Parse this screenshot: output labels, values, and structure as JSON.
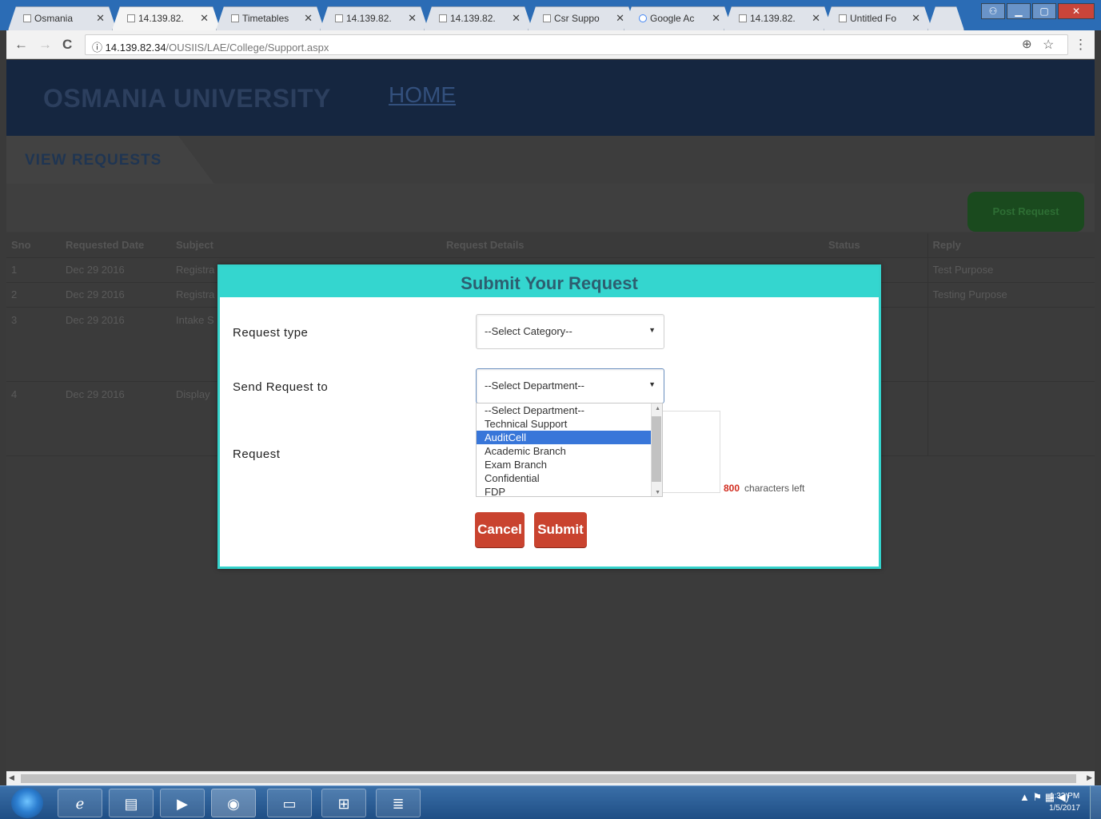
{
  "browser": {
    "tabs": [
      {
        "label": "Osmania",
        "active": false
      },
      {
        "label": "14.139.82.",
        "active": true
      },
      {
        "label": "Timetables",
        "active": false
      },
      {
        "label": "14.139.82.",
        "active": false
      },
      {
        "label": "14.139.82.",
        "active": false
      },
      {
        "label": "Csr Suppo",
        "active": false
      },
      {
        "label": "Google Ac",
        "active": false
      },
      {
        "label": "14.139.82.",
        "active": false
      },
      {
        "label": "Untitled Fo",
        "active": false
      }
    ],
    "url_host": "14.139.82.34",
    "url_path": "/OUSIIS/LAE/College/Support.aspx",
    "back_icon": "←",
    "forward_icon": "→",
    "reload_icon": "C",
    "zoom_icon": "⊕",
    "star_icon": "☆",
    "menu_icon": "⋮"
  },
  "site": {
    "title": "OSMANIA UNIVERSITY",
    "home_link": "HOME",
    "section_tab": "VIEW REQUESTS",
    "post_button": "Post Request"
  },
  "table": {
    "headers": [
      "Sno",
      "Requested Date",
      "Subject",
      "Request Details",
      "Status",
      "Reply"
    ],
    "rows": [
      {
        "sno": "1",
        "date": "Dec 29 2016",
        "subject": "Registra",
        "details": "",
        "status": "",
        "reply": "Test Purpose"
      },
      {
        "sno": "2",
        "date": "Dec 29 2016",
        "subject": "Registra",
        "details": "",
        "status": "",
        "reply": "Testing Purpose"
      },
      {
        "sno": "3",
        "date": "Dec 29 2016",
        "subject": "Intake S",
        "details": "",
        "status": "",
        "reply": ""
      },
      {
        "sno": "4",
        "date": "Dec 29 2016",
        "subject": "Display",
        "details": "",
        "status": "",
        "reply": ""
      }
    ]
  },
  "modal": {
    "title": "Submit Your Request",
    "request_type_label": "Request type",
    "request_type_value": "--Select Category--",
    "send_to_label": "Send Request to",
    "send_to_value": "--Select Department--",
    "request_label": "Request",
    "department_options": [
      "--Select Department--",
      "Technical Support",
      "AuditCell",
      "Academic Branch",
      "Exam Branch",
      "Confidential",
      "FDP"
    ],
    "selected_option": "AuditCell",
    "chars_left_count": "800",
    "chars_left_text": "characters left",
    "cancel_button": "Cancel",
    "submit_button": "Submit"
  },
  "taskbar": {
    "apps": [
      "ie-icon",
      "explorer-icon",
      "media-player-icon",
      "chrome-icon",
      "notepad-icon",
      "excel-icon",
      "word-icon"
    ],
    "time": "1:33 PM",
    "date": "1/5/2017"
  },
  "colors": {
    "modal_header": "#34d6cf",
    "button_red": "#c9432f",
    "selection_blue": "#3876d9"
  }
}
